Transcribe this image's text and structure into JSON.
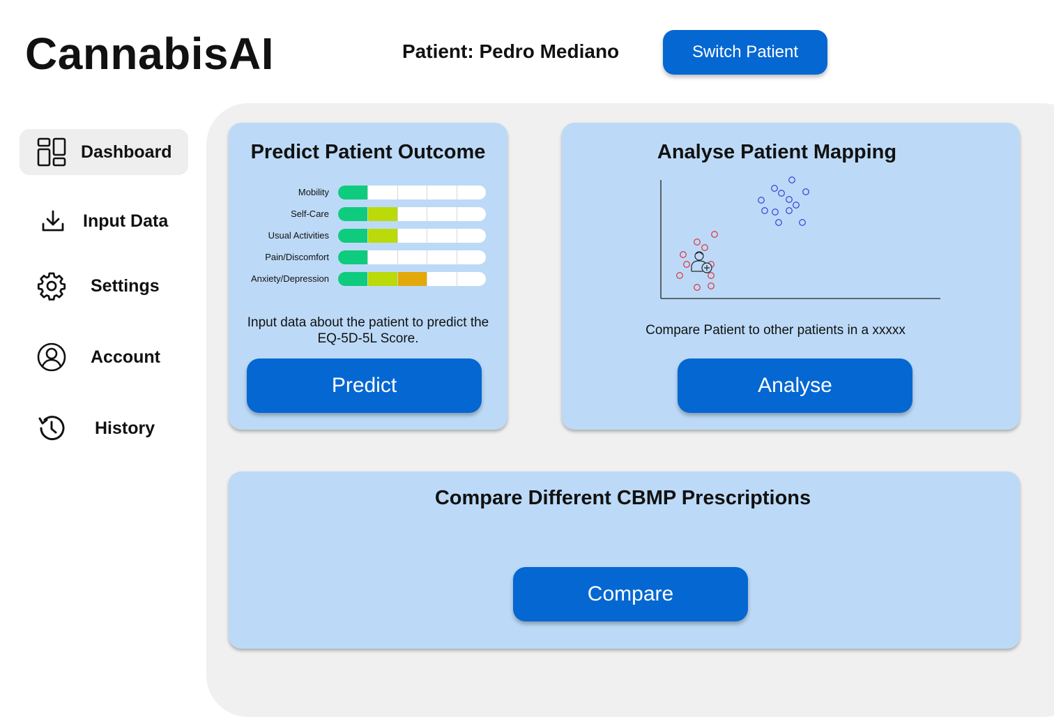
{
  "header": {
    "app_title": "CannabisAI",
    "patient_label": "Patient: Pedro Mediano",
    "switch_button": "Switch Patient"
  },
  "sidebar": {
    "items": [
      {
        "label": "Dashboard",
        "icon": "dashboard-icon",
        "active": true
      },
      {
        "label": "Input Data",
        "icon": "download-icon",
        "active": false
      },
      {
        "label": "Settings",
        "icon": "gear-icon",
        "active": false
      },
      {
        "label": "Account",
        "icon": "user-circle-icon",
        "active": false
      },
      {
        "label": "History",
        "icon": "history-icon",
        "active": false
      }
    ]
  },
  "predict_card": {
    "title": "Predict Patient Outcome",
    "metrics": [
      {
        "label": "Mobility",
        "level": 1
      },
      {
        "label": "Self-Care",
        "level": 2
      },
      {
        "label": "Usual Activities",
        "level": 2
      },
      {
        "label": "Pain/Discomfort",
        "level": 1
      },
      {
        "label": "Anxiety/Depression",
        "level": 3
      }
    ],
    "max_level": 5,
    "level_colors": [
      "#0ecb7e",
      "#bada0a",
      "#e3a90a"
    ],
    "description": "Input data about the patient to predict the EQ-5D-5L Score.",
    "button": "Predict"
  },
  "mapping_card": {
    "title": "Analyse Patient Mapping",
    "description": "Compare Patient to other patients in a xxxxx",
    "button": "Analyse",
    "cluster_colors": {
      "red": "#e0202c",
      "blue": "#2430d8"
    },
    "patient_marker_icon": "patient-medical-icon"
  },
  "compare_card": {
    "title": "Compare Different CBMP Prescriptions",
    "button": "Compare"
  },
  "colors": {
    "accent": "#0567d2",
    "card_bg": "#bcdaf7",
    "panel_bg": "#f0f0f0"
  }
}
